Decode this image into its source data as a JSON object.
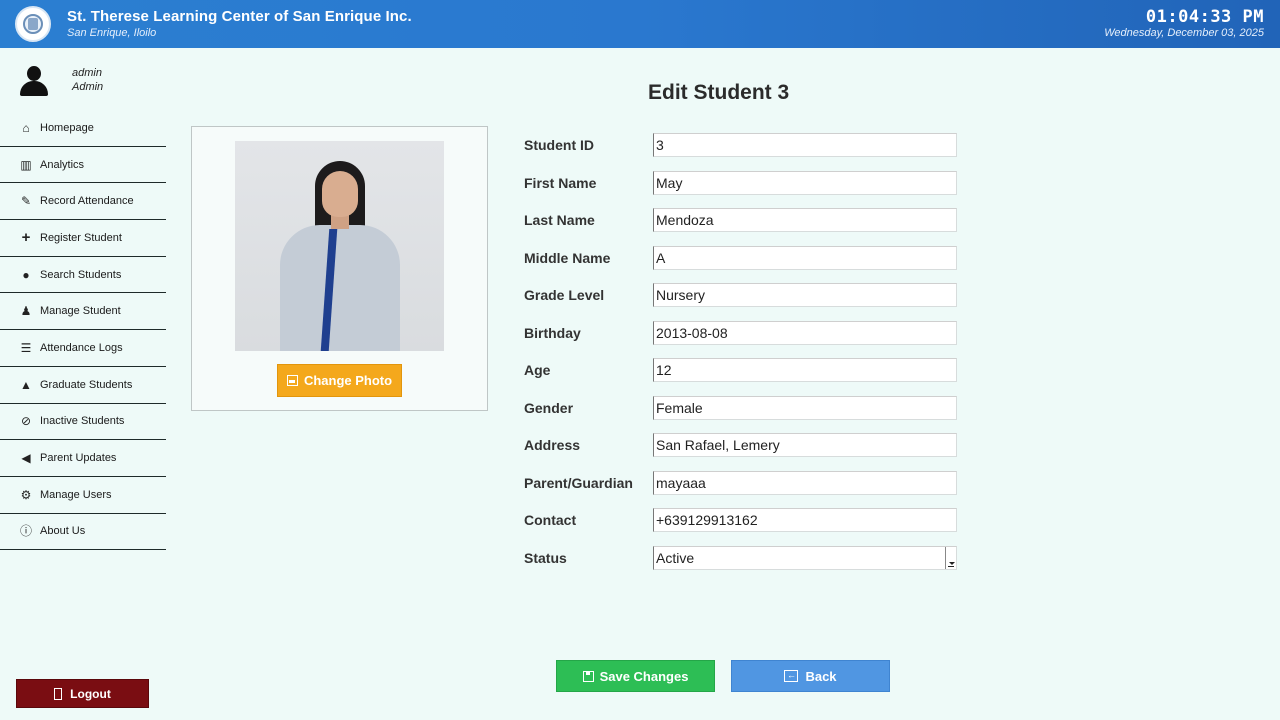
{
  "header": {
    "school_name": "St. Therese Learning Center of San Enrique Inc.",
    "location": "San Enrique, Iloilo",
    "time": "01:04:33 PM",
    "date": "Wednesday, December 03, 2025"
  },
  "user": {
    "name": "admin",
    "role": "Admin"
  },
  "nav": [
    {
      "label": "Homepage",
      "icon": "home-icon"
    },
    {
      "label": "Analytics",
      "icon": "bar-chart-icon"
    },
    {
      "label": "Record Attendance",
      "icon": "edit-icon"
    },
    {
      "label": "Register Student",
      "icon": "plus-icon"
    },
    {
      "label": "Search Students",
      "icon": "search-icon"
    },
    {
      "label": "Manage Student",
      "icon": "user-icon"
    },
    {
      "label": "Attendance Logs",
      "icon": "list-icon"
    },
    {
      "label": "Graduate Students",
      "icon": "graduation-cap-icon"
    },
    {
      "label": "Inactive Students",
      "icon": "ban-icon"
    },
    {
      "label": "Parent Updates",
      "icon": "megaphone-icon"
    },
    {
      "label": "Manage Users",
      "icon": "gear-icon"
    },
    {
      "label": "About Us",
      "icon": "info-icon"
    }
  ],
  "logout_label": "Logout",
  "page_title": "Edit Student 3",
  "change_photo_label": "Change Photo",
  "form": {
    "student_id": {
      "label": "Student ID",
      "value": "3"
    },
    "first_name": {
      "label": "First Name",
      "value": "May"
    },
    "last_name": {
      "label": "Last Name",
      "value": "Mendoza"
    },
    "middle_name": {
      "label": "Middle Name",
      "value": "A"
    },
    "grade_level": {
      "label": "Grade Level",
      "value": "Nursery"
    },
    "birthday": {
      "label": "Birthday",
      "value": "2013-08-08"
    },
    "age": {
      "label": "Age",
      "value": "12"
    },
    "gender": {
      "label": "Gender",
      "value": "Female"
    },
    "address": {
      "label": "Address",
      "value": "San Rafael, Lemery"
    },
    "parent": {
      "label": "Parent/Guardian",
      "value": "mayaaa"
    },
    "contact": {
      "label": "Contact",
      "value": "+639129913162"
    },
    "status": {
      "label": "Status",
      "value": "Active"
    }
  },
  "save_label": "Save Changes",
  "back_label": "Back"
}
